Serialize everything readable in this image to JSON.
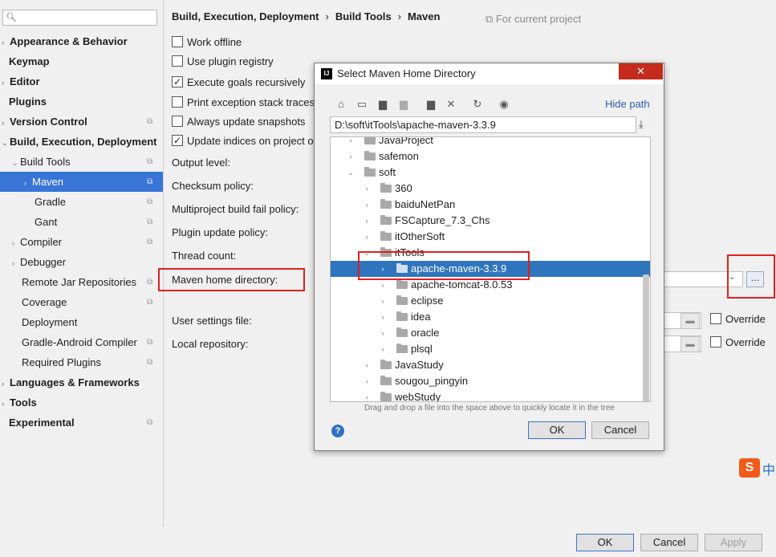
{
  "sidebar": {
    "search_placeholder": "",
    "items": [
      {
        "label": "Appearance & Behavior"
      },
      {
        "label": "Keymap"
      },
      {
        "label": "Editor"
      },
      {
        "label": "Plugins"
      },
      {
        "label": "Version Control"
      },
      {
        "label": "Build, Execution, Deployment"
      },
      {
        "label": "Build Tools"
      },
      {
        "label": "Maven"
      },
      {
        "label": "Gradle"
      },
      {
        "label": "Gant"
      },
      {
        "label": "Compiler"
      },
      {
        "label": "Debugger"
      },
      {
        "label": "Remote Jar Repositories"
      },
      {
        "label": "Coverage"
      },
      {
        "label": "Deployment"
      },
      {
        "label": "Gradle-Android Compiler"
      },
      {
        "label": "Required Plugins"
      },
      {
        "label": "Languages & Frameworks"
      },
      {
        "label": "Tools"
      },
      {
        "label": "Experimental"
      }
    ]
  },
  "breadcrumb": {
    "parts": [
      "Build, Execution, Deployment",
      "Build Tools",
      "Maven"
    ],
    "separator": "›"
  },
  "for_current_project": "For current project",
  "options": [
    {
      "label": "Work offline",
      "checked": false
    },
    {
      "label": "Use plugin registry",
      "checked": false
    },
    {
      "label": "Execute goals recursively",
      "checked": true
    },
    {
      "label": "Print exception stack traces",
      "checked": false
    },
    {
      "label": "Always update snapshots",
      "checked": false
    },
    {
      "label": "Update indices on project o",
      "checked": true
    }
  ],
  "fields": {
    "output_level": "Output level:",
    "checksum_policy": "Checksum policy:",
    "multiproject_policy": "Multiproject build fail policy:",
    "plugin_update_policy": "Plugin update policy:",
    "thread_count": "Thread count:",
    "maven_home": "Maven home directory:",
    "user_settings": "User settings file:",
    "local_repo": "Local repository:",
    "override": "Override",
    "browse": "..."
  },
  "buttons": {
    "ok": "OK",
    "cancel": "Cancel",
    "apply": "Apply"
  },
  "dialog": {
    "title": "Select Maven Home Directory",
    "logo": "IJ",
    "close": "✕",
    "hide_path": "Hide path",
    "path": "D:\\soft\\itTools\\apache-maven-3.3.9",
    "tree": [
      {
        "name": "JavaProject"
      },
      {
        "name": "safemon"
      },
      {
        "name": "soft"
      },
      {
        "name": "360"
      },
      {
        "name": "baiduNetPan"
      },
      {
        "name": "FSCapture_7.3_Chs"
      },
      {
        "name": "itOtherSoft"
      },
      {
        "name": "itTools"
      },
      {
        "name": "apache-maven-3.3.9"
      },
      {
        "name": "apache-tomcat-8.0.53"
      },
      {
        "name": "eclipse"
      },
      {
        "name": "idea"
      },
      {
        "name": "oracle"
      },
      {
        "name": "plsql"
      },
      {
        "name": "JavaStudy"
      },
      {
        "name": "sougou_pingyin"
      },
      {
        "name": "webStudy"
      }
    ],
    "hint": "Drag and drop a file into the space above to quickly locate it in the tree",
    "ok": "OK",
    "cancel": "Cancel",
    "help": "?"
  },
  "ime": {
    "logo": "S",
    "lang": "中"
  },
  "colors": {
    "selection": "#3875d7",
    "highlight": "#e02020",
    "dialog_close": "#c42b1c"
  }
}
